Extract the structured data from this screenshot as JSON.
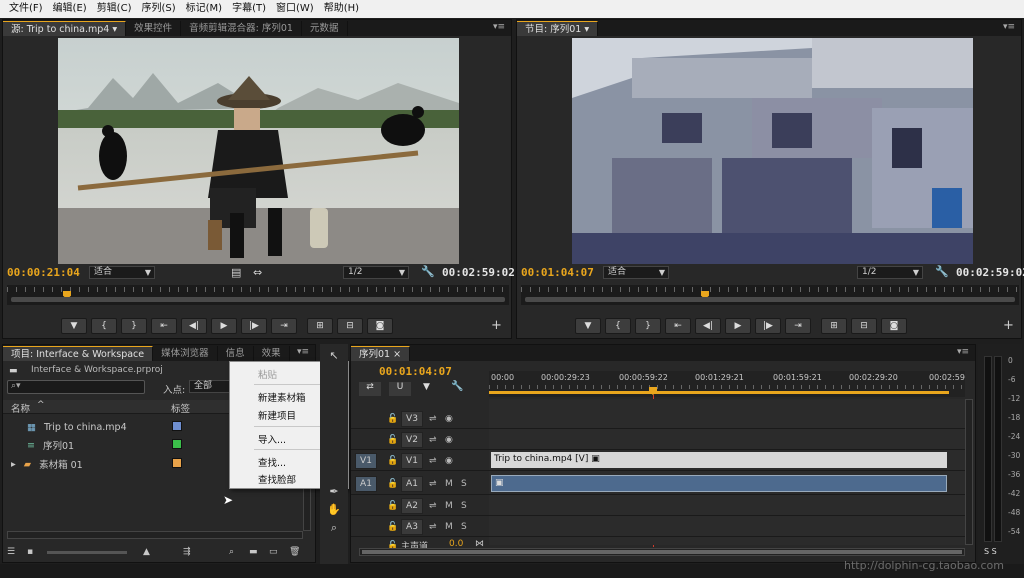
{
  "menu": [
    "文件(F)",
    "编辑(E)",
    "剪辑(C)",
    "序列(S)",
    "标记(M)",
    "字幕(T)",
    "窗口(W)",
    "帮助(H)"
  ],
  "source_panel": {
    "tabs": [
      "源: Trip to china.mp4 ▾",
      "效果控件",
      "音频剪辑混合器: 序列01",
      "元数据"
    ],
    "timecode_left": "00:00:21:04",
    "zoom": "适合",
    "resolution": "1/2",
    "timecode_right": "00:02:59:02"
  },
  "program_panel": {
    "tabs": [
      "节目: 序列01 ▾"
    ],
    "timecode_left": "00:01:04:07",
    "zoom": "适合",
    "resolution": "1/2",
    "timecode_right": "00:02:59:02"
  },
  "project_panel": {
    "tabs": [
      "项目: Interface & Workspace",
      "媒体浏览器",
      "信息",
      "效果"
    ],
    "file_name": "Interface & Workspace.prproj",
    "in_point_label": "入点:",
    "in_point_value": "全部",
    "col_name": "名称",
    "col_label": "标签",
    "items": [
      {
        "name": "Trip to china.mp4",
        "color": "#6f8fd0"
      },
      {
        "name": "序列01",
        "color": "#3bbf4a"
      },
      {
        "name": "素材箱 01",
        "color": "#e9a34a"
      }
    ]
  },
  "context_menu": {
    "paste": "粘贴",
    "new_bin": "新建素材箱",
    "new_item": "新建项目",
    "import": "导入...",
    "find": "查找...",
    "find_face": "查找脸部"
  },
  "timeline": {
    "tab": "序列01",
    "timecode": "00:01:04:07",
    "ruler_labels": [
      "00:00",
      "00:00:29:23",
      "00:00:59:22",
      "00:01:29:21",
      "00:01:59:21",
      "00:02:29:20",
      "00:02:59"
    ],
    "tracks": [
      "V3",
      "V2",
      "V1",
      "A1",
      "A2",
      "A3"
    ],
    "source_patch_v": "V1",
    "source_patch_a": "A1",
    "master": "主声道",
    "master_val": "0.0",
    "clip_video": "Trip to china.mp4 [V]",
    "mute": "M",
    "solo": "S"
  },
  "meter": {
    "labels": [
      "0",
      "-6",
      "-12",
      "-18",
      "-24",
      "-30",
      "-36",
      "-42",
      "-48",
      "-54"
    ],
    "bottom": "S  S"
  },
  "watermark": "http://dolphin-cg.taobao.com"
}
